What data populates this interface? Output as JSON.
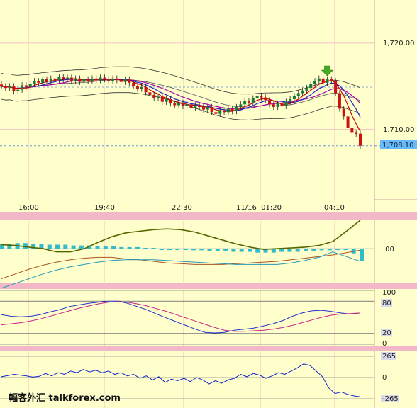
{
  "watermark": "輻客外汇 talkforex.com",
  "colors": {
    "background": "#ffffcc",
    "grid": "#f0c0c0",
    "separator": "#f2b8c8",
    "bull": "#1a7a3a",
    "bear": "#cc1111",
    "band": "#333333",
    "ma_fast": "#cc0000",
    "ma_mid": "#2222cc",
    "ma_slow": "#aa00aa",
    "last_price_bg": "#66bbff",
    "arrow": "#44aa22"
  },
  "chart_data": [
    {
      "type": "candlestick",
      "panel": "price",
      "price_labels": [
        "1,720.00",
        "1,710.00"
      ],
      "last_price_label": "1,708.10",
      "price_levels": [
        1720.0,
        1710.0,
        1708.1,
        1714.9
      ],
      "ylim": [
        1702.0,
        1725.0
      ],
      "time_labels": [
        "16:00",
        "19:40",
        "22:30",
        "11/16  01:20",
        "04:10"
      ],
      "close": [
        1715.0,
        1714.8,
        1715.0,
        1714.4,
        1714.6,
        1715.1,
        1714.9,
        1715.3,
        1715.6,
        1715.4,
        1715.8,
        1715.5,
        1715.9,
        1715.7,
        1716.1,
        1715.8,
        1716.0,
        1715.6,
        1715.9,
        1715.5,
        1715.8,
        1715.6,
        1715.9,
        1715.7,
        1716.0,
        1715.8,
        1715.6,
        1715.9,
        1715.7,
        1715.5,
        1715.8,
        1715.4,
        1715.0,
        1714.7,
        1714.9,
        1714.3,
        1714.0,
        1713.6,
        1713.8,
        1713.2,
        1713.5,
        1713.0,
        1712.8,
        1713.1,
        1712.7,
        1712.9,
        1712.5,
        1712.8,
        1712.6,
        1712.3,
        1712.6,
        1712.0,
        1711.8,
        1712.2,
        1712.0,
        1712.4,
        1712.1,
        1712.6,
        1712.9,
        1713.3,
        1713.1,
        1713.6,
        1713.9,
        1713.7,
        1713.4,
        1712.9,
        1712.6,
        1713.0,
        1712.7,
        1713.2,
        1713.5,
        1713.9,
        1714.2,
        1714.5,
        1714.8,
        1715.3,
        1715.6,
        1715.9,
        1715.4,
        1715.8,
        1715.6,
        1714.2,
        1712.4,
        1711.5,
        1710.2,
        1709.6,
        1709.5,
        1708.1
      ]
    },
    {
      "type": "line",
      "panel": "macd",
      "tick_labels": [
        ".00"
      ],
      "hist": [
        0.6,
        0.6,
        0.7,
        0.7,
        0.6,
        0.6,
        0.5,
        0.5,
        0.5,
        0.4,
        0.4,
        0.4,
        0.3,
        0.3,
        0.3,
        0.2,
        0.2,
        0.2,
        0.1,
        0.1,
        0.0,
        0.0,
        -0.1,
        -0.1,
        -0.2,
        -0.2,
        -0.3,
        -0.3,
        -0.3,
        -0.4,
        -0.4,
        -0.4,
        -0.5,
        -0.5,
        -0.5,
        -0.4,
        -0.4,
        -0.4,
        -0.3,
        -0.3,
        -0.2,
        -0.2,
        -0.1,
        -0.1,
        -0.6,
        -1.6
      ],
      "series": [
        {
          "name": "",
          "values": [
            0.5,
            0.4,
            0.2,
            0.0,
            -0.4,
            -0.4,
            0.0,
            0.8,
            1.5,
            2.0,
            2.2,
            2.4,
            2.5,
            2.4,
            2.1,
            1.6,
            1.1,
            0.6,
            0.2,
            -0.1,
            0.0,
            0.1,
            0.2,
            0.4,
            0.9,
            2.2,
            3.6
          ]
        },
        {
          "name": "",
          "values": [
            -3.8,
            -3.2,
            -2.6,
            -2.1,
            -1.7,
            -1.4,
            -1.2,
            -1.1,
            -1.1,
            -1.3,
            -1.4,
            -1.6,
            -1.8,
            -1.9,
            -2.0,
            -2.0,
            -2.0,
            -1.9,
            -1.8,
            -1.7,
            -1.6,
            -1.4,
            -1.2,
            -1.0,
            -0.8,
            -0.5,
            -0.2
          ]
        },
        {
          "name": "",
          "values": [
            -5.0,
            -4.4,
            -3.8,
            -3.2,
            -2.7,
            -2.3,
            -2.0,
            -1.7,
            -1.5,
            -1.4,
            -1.4,
            -1.4,
            -1.5,
            -1.6,
            -1.7,
            -1.8,
            -1.9,
            -2.0,
            -2.0,
            -2.0,
            -2.0,
            -1.8,
            -1.5,
            -1.1,
            -0.4,
            -1.0,
            -1.6
          ]
        }
      ],
      "ylim": [
        -4.2,
        3.5
      ]
    },
    {
      "type": "line",
      "panel": "stochastic",
      "tick_labels": [
        "100",
        "80",
        "20",
        "0"
      ],
      "levels": [
        100,
        80,
        20,
        0
      ],
      "series": [
        {
          "name": "",
          "values": [
            55,
            52,
            51,
            52,
            55,
            60,
            64,
            70,
            73,
            76,
            78,
            80,
            80,
            76,
            70,
            64,
            56,
            49,
            42,
            35,
            28,
            22,
            21,
            22,
            26,
            28,
            30,
            34,
            38,
            44,
            52,
            58,
            62,
            63,
            61,
            58,
            56,
            58
          ]
        },
        {
          "name": "",
          "values": [
            36,
            38,
            40,
            43,
            47,
            52,
            57,
            62,
            67,
            71,
            75,
            78,
            79,
            78,
            75,
            71,
            66,
            61,
            55,
            49,
            43,
            37,
            31,
            26,
            24,
            24,
            25,
            26,
            28,
            31,
            35,
            40,
            45,
            50,
            54,
            56,
            57,
            58
          ]
        }
      ],
      "ylim": [
        0,
        100
      ]
    },
    {
      "type": "line",
      "panel": "cci",
      "tick_labels": [
        "265",
        "0",
        "-265"
      ],
      "levels": [
        265,
        0,
        -265
      ],
      "series": [
        {
          "name": "",
          "values": [
            10,
            25,
            40,
            30,
            20,
            5,
            15,
            50,
            20,
            60,
            40,
            80,
            60,
            100,
            70,
            90,
            60,
            80,
            40,
            60,
            20,
            40,
            -10,
            20,
            -30,
            10,
            -60,
            -20,
            -40,
            -10,
            -50,
            0,
            -30,
            -80,
            -40,
            -70,
            -30,
            -10,
            40,
            10,
            50,
            30,
            -10,
            20,
            60,
            40,
            80,
            120,
            170,
            150,
            80,
            10,
            -130,
            -200,
            -180,
            -210,
            -230,
            -240
          ]
        }
      ],
      "ylim": [
        -300,
        300
      ]
    }
  ]
}
